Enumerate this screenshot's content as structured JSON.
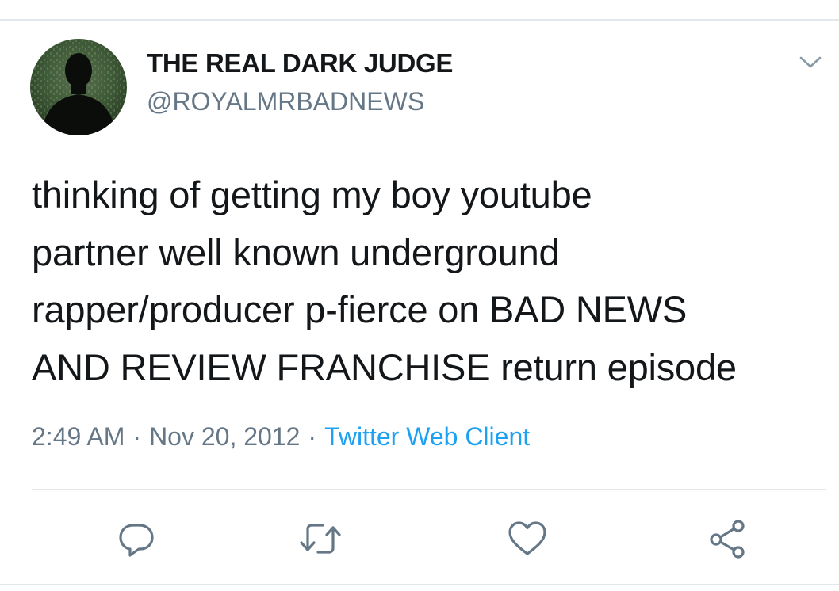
{
  "tweet": {
    "display_name": "THE REAL DARK JUDGE",
    "handle": "@ROYALMRBADNEWS",
    "text_lines": [
      "thinking of getting my boy youtube",
      "partner well known underground",
      "rapper/producer p-fierce on BAD NEWS",
      "AND REVIEW FRANCHISE return episode"
    ],
    "time": "2:49 AM",
    "separator": "·",
    "date": "Nov 20, 2012",
    "source": "Twitter Web Client"
  },
  "icons": {
    "caret": "chevron-down-icon",
    "reply": "reply-icon",
    "retweet": "retweet-icon",
    "like": "heart-icon",
    "share": "share-icon"
  },
  "colors": {
    "text": "#14171a",
    "secondary": "#657786",
    "link": "#1da1f2",
    "divider": "#e4e8eb"
  }
}
